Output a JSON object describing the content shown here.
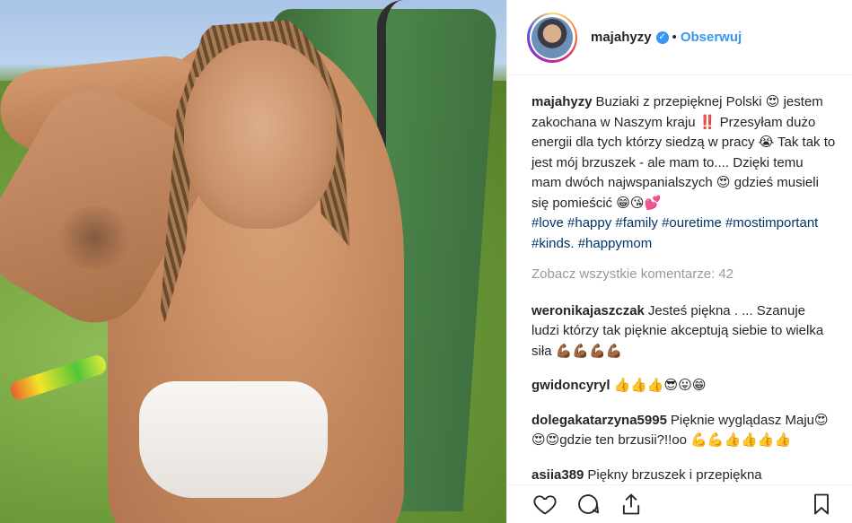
{
  "post": {
    "username": "majahyzy",
    "verified_icon": "verified-badge-icon",
    "separator": "•",
    "follow_label": "Obserwuj"
  },
  "caption": {
    "author": "majahyzy",
    "text": "Buziaki z przepięknej Polski 😍 jestem zakochana w Naszym kraju ‼️ Przesyłam dużo energii dla tych którzy siedzą w pracy 😭 Tak tak to jest mój brzuszek - ale mam to.... Dzięki temu mam dwóch najwspanialszych 😍 gdzieś musieli się pomieścić 😁😘💕",
    "hashtags": "#love #happy #family #ouretime #mostimportant #kinds. #happymom"
  },
  "view_all": "Zobacz wszystkie komentarze: 42",
  "comments": [
    {
      "author": "weronikajaszczak",
      "text": "Jesteś piękna . ... Szanuje ludzi którzy tak pięknie akceptują siebie to wielka siła 💪🏾💪🏾💪🏾💪🏾"
    },
    {
      "author": "gwidoncyryl",
      "text": "👍👍👍😎😛😁"
    },
    {
      "author": "dolegakatarzyna5995",
      "text": "Pięknie wyglądasz Maju😍😍😍gdzie ten brzusii?!!oo 💪💪👍👍👍👍"
    },
    {
      "author": "asiia389",
      "text": "Piękny brzuszek i przepiękna"
    }
  ],
  "actions": [
    "heart-icon",
    "comment-icon",
    "share-icon",
    "bookmark-icon"
  ],
  "colors": {
    "link": "#3897f0",
    "hashtag": "#003569",
    "muted": "#999999"
  }
}
